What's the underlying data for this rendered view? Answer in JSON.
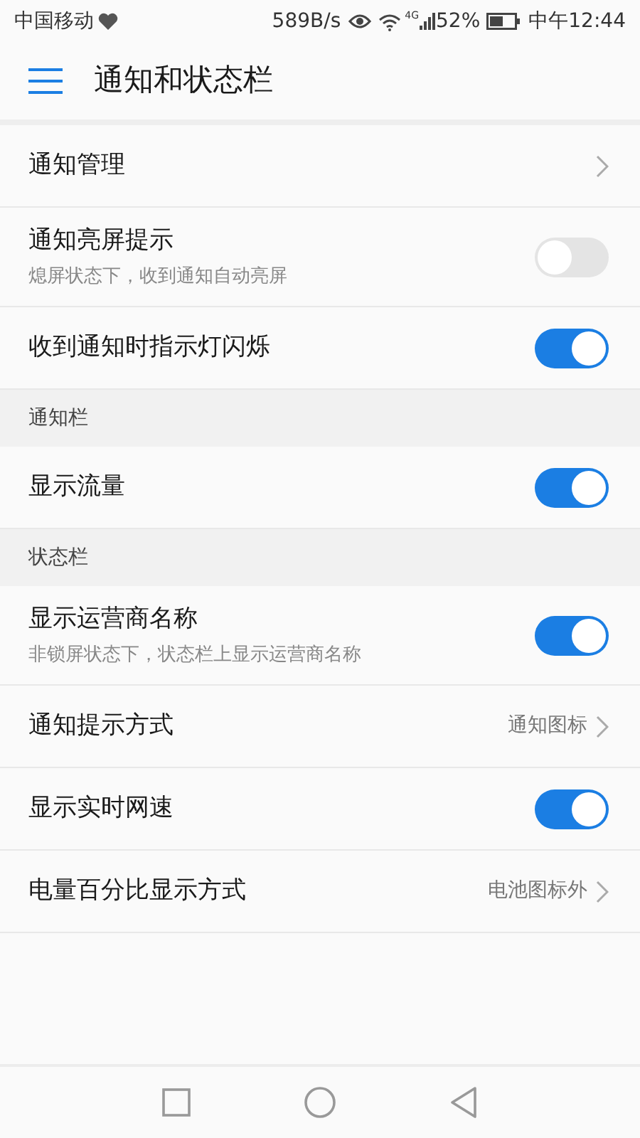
{
  "status_bar": {
    "carrier": "中国移动",
    "speed": "589B/s",
    "network": "4G",
    "battery_percent": "52%",
    "time": "中午12:44"
  },
  "header": {
    "title": "通知和状态栏"
  },
  "sections": [
    {
      "items": [
        {
          "kind": "link",
          "title": "通知管理"
        },
        {
          "kind": "toggle",
          "title": "通知亮屏提示",
          "subtitle": "熄屏状态下，收到通知自动亮屏",
          "on": false
        },
        {
          "kind": "toggle",
          "title": "收到通知时指示灯闪烁",
          "on": true
        }
      ]
    },
    {
      "heading": "通知栏",
      "items": [
        {
          "kind": "toggle",
          "title": "显示流量",
          "on": true
        }
      ]
    },
    {
      "heading": "状态栏",
      "items": [
        {
          "kind": "toggle",
          "title": "显示运营商名称",
          "subtitle": "非锁屏状态下，状态栏上显示运营商名称",
          "on": true
        },
        {
          "kind": "link",
          "title": "通知提示方式",
          "value": "通知图标"
        },
        {
          "kind": "toggle",
          "title": "显示实时网速",
          "on": true
        },
        {
          "kind": "link",
          "title": "电量百分比显示方式",
          "value": "电池图标外"
        }
      ]
    }
  ]
}
